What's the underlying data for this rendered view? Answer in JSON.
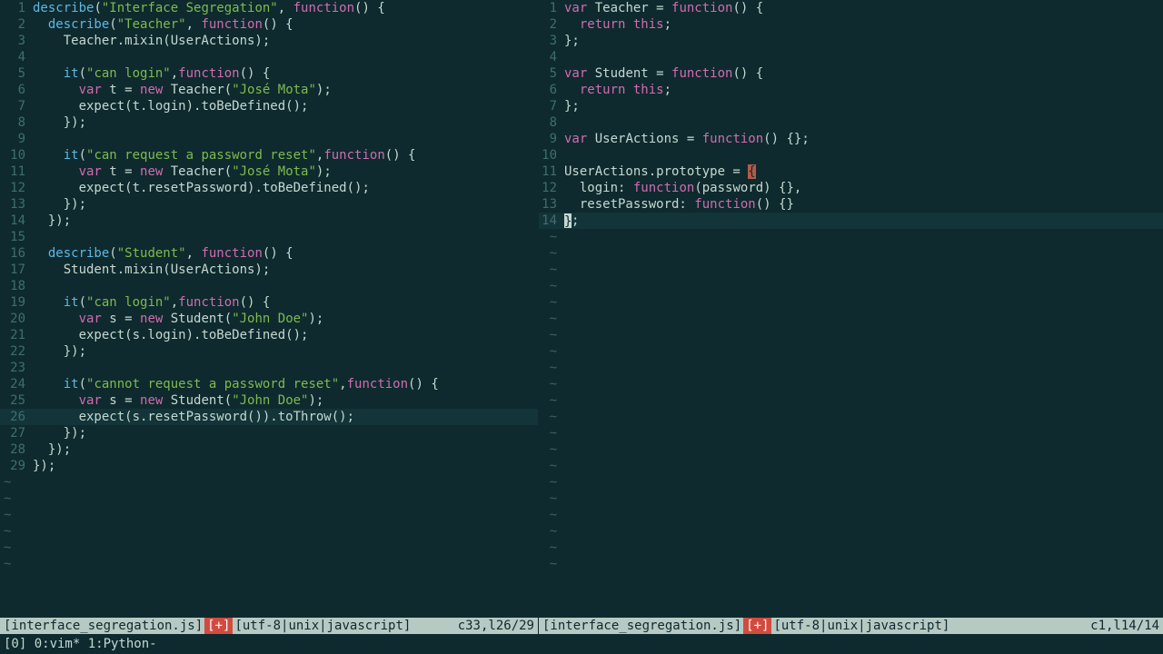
{
  "left": {
    "status": {
      "filename": "[interface_segregation.js]",
      "modified": "[+]",
      "info": "[utf-8|unix|javascript]",
      "pos": "c33,l26/29"
    },
    "lines": [
      {
        "n": 1,
        "t": [
          [
            "fn",
            "describe"
          ],
          [
            "op",
            "("
          ],
          [
            "str",
            "\"Interface Segregation\""
          ],
          [
            "op",
            ", "
          ],
          [
            "key",
            "function"
          ],
          [
            "op",
            "() {"
          ]
        ]
      },
      {
        "n": 2,
        "t": [
          [
            "sp",
            "  "
          ],
          [
            "fn",
            "describe"
          ],
          [
            "op",
            "("
          ],
          [
            "str",
            "\"Teacher\""
          ],
          [
            "op",
            ", "
          ],
          [
            "key",
            "function"
          ],
          [
            "op",
            "() {"
          ]
        ]
      },
      {
        "n": 3,
        "t": [
          [
            "sp",
            "    "
          ],
          [
            "id",
            "Teacher.mixin(UserActions);"
          ]
        ]
      },
      {
        "n": 4,
        "t": []
      },
      {
        "n": 5,
        "t": [
          [
            "sp",
            "    "
          ],
          [
            "fn",
            "it"
          ],
          [
            "op",
            "("
          ],
          [
            "str",
            "\"can login\""
          ],
          [
            "op",
            ","
          ],
          [
            "key",
            "function"
          ],
          [
            "op",
            "() {"
          ]
        ]
      },
      {
        "n": 6,
        "t": [
          [
            "sp",
            "      "
          ],
          [
            "key",
            "var"
          ],
          [
            "op",
            " t = "
          ],
          [
            "key",
            "new"
          ],
          [
            "op",
            " Teacher("
          ],
          [
            "str",
            "\"José Mota\""
          ],
          [
            "op",
            ");"
          ]
        ]
      },
      {
        "n": 7,
        "t": [
          [
            "sp",
            "      "
          ],
          [
            "id",
            "expect(t.login).toBeDefined();"
          ]
        ]
      },
      {
        "n": 8,
        "t": [
          [
            "sp",
            "    "
          ],
          [
            "op",
            "});"
          ]
        ]
      },
      {
        "n": 9,
        "t": []
      },
      {
        "n": 10,
        "t": [
          [
            "sp",
            "    "
          ],
          [
            "fn",
            "it"
          ],
          [
            "op",
            "("
          ],
          [
            "str",
            "\"can request a password reset\""
          ],
          [
            "op",
            ","
          ],
          [
            "key",
            "function"
          ],
          [
            "op",
            "() {"
          ]
        ]
      },
      {
        "n": 11,
        "t": [
          [
            "sp",
            "      "
          ],
          [
            "key",
            "var"
          ],
          [
            "op",
            " t = "
          ],
          [
            "key",
            "new"
          ],
          [
            "op",
            " Teacher("
          ],
          [
            "str",
            "\"José Mota\""
          ],
          [
            "op",
            ");"
          ]
        ]
      },
      {
        "n": 12,
        "t": [
          [
            "sp",
            "      "
          ],
          [
            "id",
            "expect(t.resetPassword).toBeDefined();"
          ]
        ]
      },
      {
        "n": 13,
        "t": [
          [
            "sp",
            "    "
          ],
          [
            "op",
            "});"
          ]
        ]
      },
      {
        "n": 14,
        "t": [
          [
            "sp",
            "  "
          ],
          [
            "op",
            "});"
          ]
        ]
      },
      {
        "n": 15,
        "t": []
      },
      {
        "n": 16,
        "t": [
          [
            "sp",
            "  "
          ],
          [
            "fn",
            "describe"
          ],
          [
            "op",
            "("
          ],
          [
            "str",
            "\"Student\""
          ],
          [
            "op",
            ", "
          ],
          [
            "key",
            "function"
          ],
          [
            "op",
            "() {"
          ]
        ]
      },
      {
        "n": 17,
        "t": [
          [
            "sp",
            "    "
          ],
          [
            "id",
            "Student.mixin(UserActions);"
          ]
        ]
      },
      {
        "n": 18,
        "t": []
      },
      {
        "n": 19,
        "t": [
          [
            "sp",
            "    "
          ],
          [
            "fn",
            "it"
          ],
          [
            "op",
            "("
          ],
          [
            "str",
            "\"can login\""
          ],
          [
            "op",
            ","
          ],
          [
            "key",
            "function"
          ],
          [
            "op",
            "() {"
          ]
        ]
      },
      {
        "n": 20,
        "t": [
          [
            "sp",
            "      "
          ],
          [
            "key",
            "var"
          ],
          [
            "op",
            " s = "
          ],
          [
            "key",
            "new"
          ],
          [
            "op",
            " Student("
          ],
          [
            "str",
            "\"John Doe\""
          ],
          [
            "op",
            ");"
          ]
        ]
      },
      {
        "n": 21,
        "t": [
          [
            "sp",
            "      "
          ],
          [
            "id",
            "expect(s.login).toBeDefined();"
          ]
        ]
      },
      {
        "n": 22,
        "t": [
          [
            "sp",
            "    "
          ],
          [
            "op",
            "});"
          ]
        ]
      },
      {
        "n": 23,
        "t": []
      },
      {
        "n": 24,
        "t": [
          [
            "sp",
            "    "
          ],
          [
            "fn",
            "it"
          ],
          [
            "op",
            "("
          ],
          [
            "str",
            "\"cannot request a password reset\""
          ],
          [
            "op",
            ","
          ],
          [
            "key",
            "function"
          ],
          [
            "op",
            "() {"
          ]
        ]
      },
      {
        "n": 25,
        "t": [
          [
            "sp",
            "      "
          ],
          [
            "key",
            "var"
          ],
          [
            "op",
            " s = "
          ],
          [
            "key",
            "new"
          ],
          [
            "op",
            " Student("
          ],
          [
            "str",
            "\"John Doe\""
          ],
          [
            "op",
            ");"
          ]
        ]
      },
      {
        "n": 26,
        "hl": true,
        "t": [
          [
            "sp",
            "      "
          ],
          [
            "id",
            "expect(s.resetPassword()).toThrow();"
          ]
        ]
      },
      {
        "n": 27,
        "t": [
          [
            "sp",
            "    "
          ],
          [
            "op",
            "});"
          ]
        ]
      },
      {
        "n": 28,
        "t": [
          [
            "sp",
            "  "
          ],
          [
            "op",
            "});"
          ]
        ]
      },
      {
        "n": 29,
        "t": [
          [
            "op",
            "});"
          ]
        ]
      }
    ],
    "tildes": 6
  },
  "right": {
    "status": {
      "filename": "[interface_segregation.js]",
      "modified": "[+]",
      "info": "[utf-8|unix|javascript]",
      "pos": "c1,l14/14"
    },
    "lines": [
      {
        "n": 1,
        "t": [
          [
            "key",
            "var"
          ],
          [
            "op",
            " Teacher = "
          ],
          [
            "key",
            "function"
          ],
          [
            "op",
            "() {"
          ]
        ]
      },
      {
        "n": 2,
        "t": [
          [
            "sp",
            "  "
          ],
          [
            "key",
            "return"
          ],
          [
            "op",
            " "
          ],
          [
            "key",
            "this"
          ],
          [
            "op",
            ";"
          ]
        ]
      },
      {
        "n": 3,
        "t": [
          [
            "op",
            "};"
          ]
        ]
      },
      {
        "n": 4,
        "t": []
      },
      {
        "n": 5,
        "t": [
          [
            "key",
            "var"
          ],
          [
            "op",
            " Student = "
          ],
          [
            "key",
            "function"
          ],
          [
            "op",
            "() {"
          ]
        ]
      },
      {
        "n": 6,
        "t": [
          [
            "sp",
            "  "
          ],
          [
            "key",
            "return"
          ],
          [
            "op",
            " "
          ],
          [
            "key",
            "this"
          ],
          [
            "op",
            ";"
          ]
        ]
      },
      {
        "n": 7,
        "t": [
          [
            "op",
            "};"
          ]
        ]
      },
      {
        "n": 8,
        "t": []
      },
      {
        "n": 9,
        "t": [
          [
            "key",
            "var"
          ],
          [
            "op",
            " UserActions = "
          ],
          [
            "key",
            "function"
          ],
          [
            "op",
            "() {};"
          ]
        ]
      },
      {
        "n": 10,
        "t": []
      },
      {
        "n": 11,
        "t": [
          [
            "id",
            "UserActions.prototype = "
          ],
          [
            "brhl",
            "{"
          ]
        ]
      },
      {
        "n": 12,
        "t": [
          [
            "sp",
            "  "
          ],
          [
            "id",
            "login: "
          ],
          [
            "key",
            "function"
          ],
          [
            "op",
            "(password) {},"
          ]
        ]
      },
      {
        "n": 13,
        "t": [
          [
            "sp",
            "  "
          ],
          [
            "id",
            "resetPassword: "
          ],
          [
            "key",
            "function"
          ],
          [
            "op",
            "() {}"
          ]
        ]
      },
      {
        "n": 14,
        "hl": true,
        "t": [
          [
            "cursor",
            "}"
          ],
          [
            "op",
            ";"
          ]
        ]
      }
    ],
    "tildes": 21
  },
  "tmux": "[0] 0:vim* 1:Python-"
}
